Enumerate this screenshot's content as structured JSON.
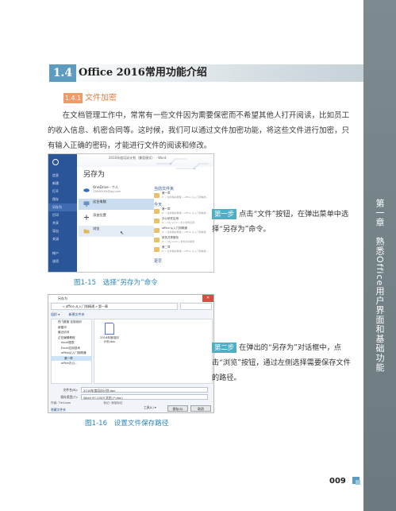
{
  "side_tab": {
    "chapter": "第一章　熟悉Office用户界面和基础功能"
  },
  "section": {
    "number": "1.4",
    "title": "Office 2016常用功能介绍"
  },
  "subsection": {
    "number": "1.4.1",
    "title": "文件加密"
  },
  "paragraph": "在文档管理工作中，常常有一些文件因为需要保密而不希望其他人打开阅读，比如员工的收入信息、机密合同等。这时候，我们可以通过文件加密功能，将这些文件进行加密，只有输入正确的密码，才能进行文件的阅读和修改。",
  "figure1": {
    "caption": "图1-15　选择“另存为”命令",
    "window_title": "2016年度培训计划（兼容模式） - Word",
    "heading": "另存为",
    "nav": [
      "信息",
      "新建",
      "打开",
      "保存",
      "另存为",
      "打印",
      "共享",
      "导出",
      "关闭",
      "帐户",
      "选项"
    ],
    "locations": [
      {
        "label": "OneDrive - 个人",
        "sub": "1384XXXX@qq.com"
      },
      {
        "label": "这台电脑",
        "sub": ""
      },
      {
        "label": "添加位置",
        "sub": ""
      },
      {
        "label": "浏览",
        "sub": ""
      }
    ],
    "recent": {
      "current_heading": "当前文件夹",
      "current": [
        {
          "name": "第一章",
          "path": "E: » 全新精彩教程 » office 从入门到精通..."
        }
      ],
      "today_heading": "今天",
      "today": [
        {
          "name": "第一章",
          "path": "E: » 全新精彩教程 » office 从入门到精通..."
        },
        {
          "name": "办公软件应用",
          "path": "D: » My work » 办公软件应用"
        },
        {
          "name": "office 从入门到精通",
          "path": "E: » 全新精彩教程 » office 从入门到精通"
        },
        {
          "name": "财务共享服务",
          "path": "D: » My work » 财务共享服务"
        },
        {
          "name": "第二章",
          "path": "E: » 全新精彩教程 » office 从入门到精通..."
        }
      ],
      "earlier_heading": "更早"
    }
  },
  "step1": {
    "tag": "第一步",
    "text": "点击“文件”按钮，在弹出菜单中选择“另存为”命令。"
  },
  "figure2": {
    "caption": "图1-16　设置文件保存路径",
    "window_title": "另存为",
    "address": "« office 从入门到精通 » 第一章",
    "toolbar": [
      "组织 ▾",
      "新建文件夹"
    ],
    "tree": [
      "西飞集团 定制培训",
      "新建词",
      "最近访问",
      "正在编辑教程",
      "excel图表",
      "Excel应用技术",
      "office从入门到精通",
      "第一章",
      "office办公..."
    ],
    "document_name": "2016年度培训计划.doc",
    "file_name_label": "文件名(N):",
    "file_name_value": "2016年度培训计划.doc",
    "file_type_label": "保存类型(T):",
    "file_type_value": "Word 97-2003 文档 (*.doc)",
    "author_label": "作者:",
    "author_value": "TieCoom",
    "tags_label": "标记:",
    "tags_value": "添加标记",
    "hide_folders": "隐藏文件夹",
    "tools": "工具(L) ▾",
    "save": "保存(S)",
    "cancel": "取消"
  },
  "step2": {
    "tag": "第二步",
    "text": "在弹出的“另存为”对话框中，点击“浏览”按钮，通过左侧选择需要保存文件的路径。"
  },
  "page_number": "009"
}
